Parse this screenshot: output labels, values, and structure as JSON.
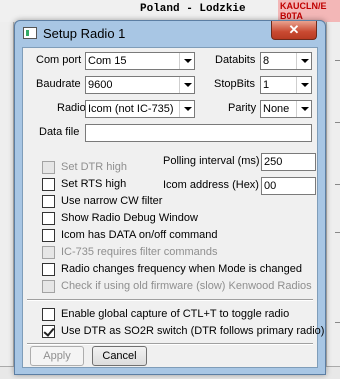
{
  "background": {
    "title": "Poland - Lodzkie",
    "badge": "KAUCLN/E B0TA"
  },
  "dialog": {
    "title": "Setup Radio 1",
    "close_label": "✕"
  },
  "fields": {
    "com_port": {
      "label": "Com port",
      "value": "Com 15"
    },
    "databits": {
      "label": "Databits",
      "value": "8"
    },
    "baudrate": {
      "label": "Baudrate",
      "value": "9600"
    },
    "stopbits": {
      "label": "StopBits",
      "value": "1"
    },
    "radio": {
      "label": "Radio",
      "value": "Icom (not IC-735)"
    },
    "parity": {
      "label": "Parity",
      "value": "None"
    },
    "data_file": {
      "label": "Data file",
      "value": ""
    },
    "polling_interval": {
      "label": "Polling interval (ms)",
      "value": "250"
    },
    "icom_address": {
      "label": "Icom address (Hex)",
      "value": "00"
    }
  },
  "checkboxes": [
    {
      "label": "Set DTR high",
      "checked": false,
      "disabled": true
    },
    {
      "label": "Set RTS high",
      "checked": false,
      "disabled": false
    },
    {
      "label": "Use narrow CW filter",
      "checked": false,
      "disabled": false
    },
    {
      "label": "Show Radio Debug Window",
      "checked": false,
      "disabled": false
    },
    {
      "label": "Icom has DATA on/off command",
      "checked": false,
      "disabled": false
    },
    {
      "label": "IC-735 requires filter commands",
      "checked": false,
      "disabled": true
    },
    {
      "label": "Radio changes frequency when Mode is changed",
      "checked": false,
      "disabled": false
    },
    {
      "label": "Check if using old firmware (slow) Kenwood Radios",
      "checked": false,
      "disabled": true
    },
    {
      "label": "Enable global capture of CTL+T to toggle radio",
      "checked": false,
      "disabled": false
    },
    {
      "label": "Use DTR as SO2R switch (DTR follows primary radio)",
      "checked": true,
      "disabled": false
    }
  ],
  "buttons": {
    "apply": "Apply",
    "cancel": "Cancel"
  }
}
